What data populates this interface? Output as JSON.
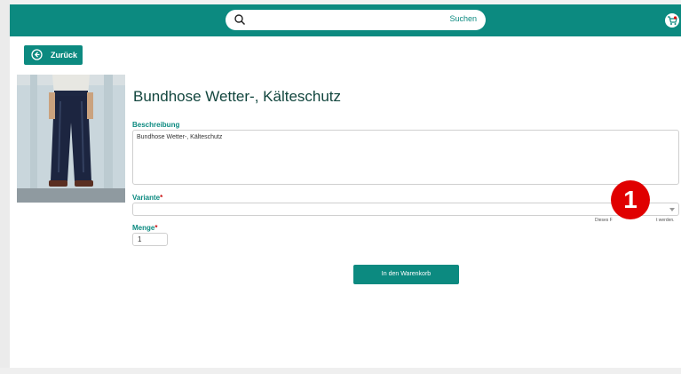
{
  "header": {
    "search_label": "Suchen"
  },
  "nav": {
    "back_label": "Zurück"
  },
  "product": {
    "title": "Bundhose Wetter-, Kälteschutz",
    "description_label": "Beschreibung",
    "description": "Bundhose Wetter-, Kälteschutz",
    "variant_label": "Variante",
    "variant_value": "",
    "variant_hint_start": "Dieses F",
    "variant_hint_end": "t werden.",
    "quantity_label": "Menge",
    "quantity_value": "1",
    "required_marker": "*",
    "add_to_cart_label": "In den Warenkorb"
  },
  "annotation": {
    "marker_number": "1"
  },
  "colors": {
    "brand": "#0c8a80",
    "marker": "#e00000",
    "required": "#c91010"
  }
}
